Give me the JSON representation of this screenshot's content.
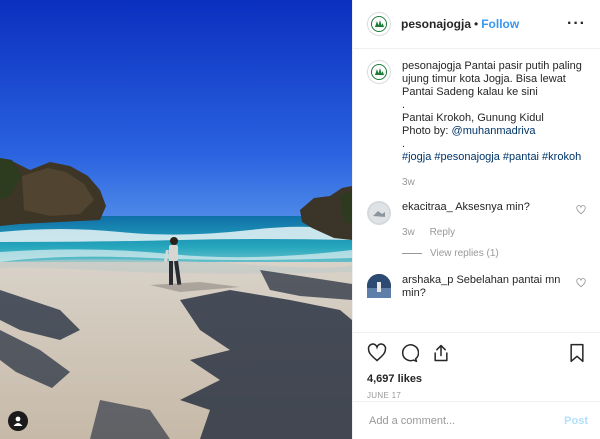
{
  "post": {
    "username": "pesonajogja",
    "follow_label": "Follow",
    "more_icon": "ellipsis-icon",
    "caption": {
      "username": "pesonajogja",
      "line1": "Pantai pasir putih paling ujung timur kota Jogja. Bisa lewat Pantai Sadeng kalau ke sini",
      "dot1": ".",
      "location": "Pantai Krokoh, Gunung Kidul",
      "photo_by": "Photo by:",
      "photo_handle": "@muhanmadriva",
      "dot2": ".",
      "tags": "#jogja #pesonajogja #pantai #krokoh",
      "time": "3w"
    },
    "comments": [
      {
        "username": "ekacitraa_",
        "text": "Aksesnya min?",
        "time": "3w",
        "reply_label": "Reply",
        "view_replies": "View replies (1)"
      },
      {
        "username": "arshaka_p",
        "text": "Sebelahan pantai mn min?"
      }
    ],
    "likes": "4,697 likes",
    "date": "JUNE 17",
    "add_comment_placeholder": "Add a comment...",
    "post_label": "Post"
  },
  "colors": {
    "link": "#3897f0",
    "tag": "#003569",
    "sky": "#1d4fd1",
    "sea": "#1f9fb6",
    "sand": "#d8cfc4"
  }
}
